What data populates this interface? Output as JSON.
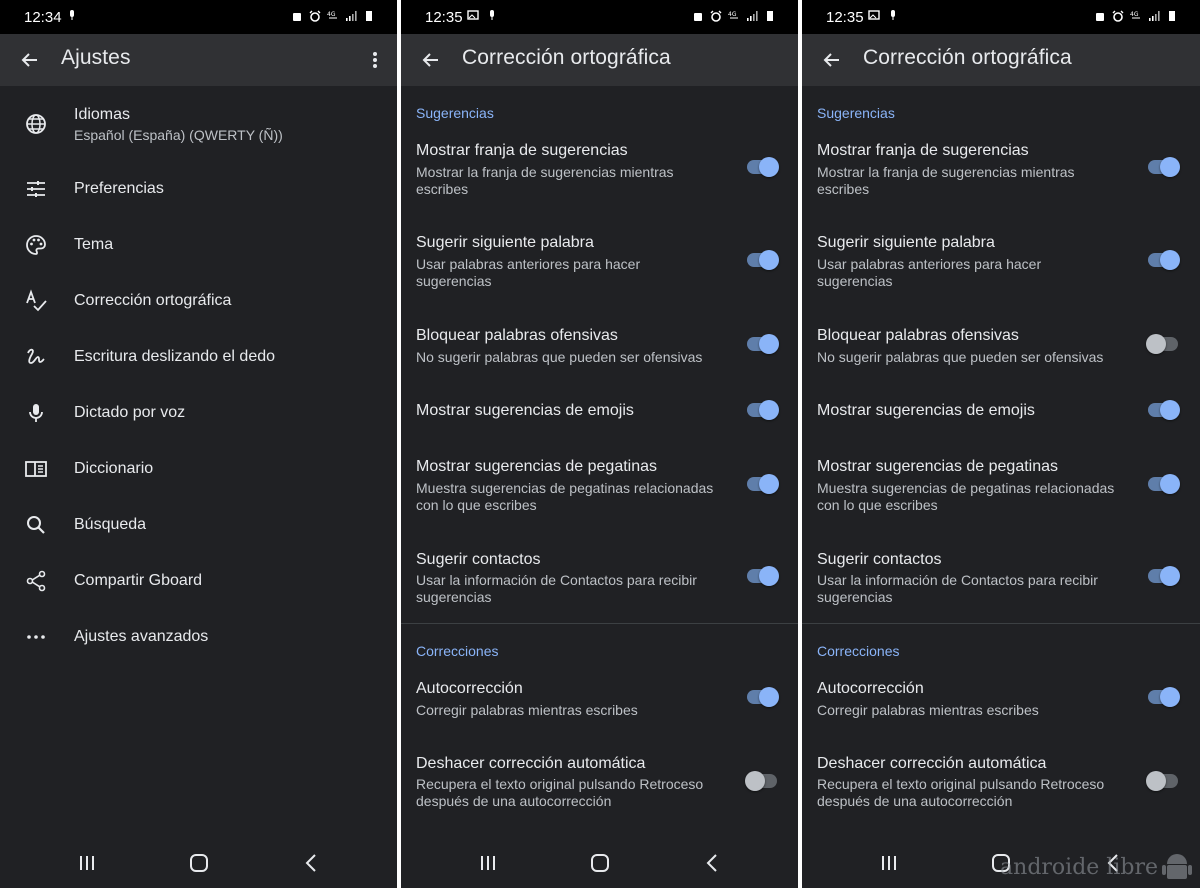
{
  "colors": {
    "accent": "#8ab4f8",
    "background": "#202124",
    "appbar": "#303134"
  },
  "panel1": {
    "status_time": "12:34",
    "title": "Ajustes",
    "items": [
      {
        "icon": "globe-icon",
        "label": "Idiomas",
        "sub": "Español (España) (QWERTY (Ñ))"
      },
      {
        "icon": "sliders-icon",
        "label": "Preferencias"
      },
      {
        "icon": "palette-icon",
        "label": "Tema"
      },
      {
        "icon": "spellcheck-icon",
        "label": "Corrección ortográfica"
      },
      {
        "icon": "gesture-icon",
        "label": "Escritura deslizando el dedo"
      },
      {
        "icon": "microphone-icon",
        "label": "Dictado por voz"
      },
      {
        "icon": "dictionary-icon",
        "label": "Diccionario"
      },
      {
        "icon": "search-icon",
        "label": "Búsqueda"
      },
      {
        "icon": "share-icon",
        "label": "Compartir Gboard"
      },
      {
        "icon": "more-horizontal-icon",
        "label": "Ajustes avanzados"
      }
    ]
  },
  "panel2": {
    "status_time": "12:35",
    "title": "Corrección ortográfica",
    "section_suggestions": "Sugerencias",
    "section_corrections": "Correcciones",
    "prefs": [
      {
        "title": "Mostrar franja de sugerencias",
        "summary": "Mostrar la franja de sugerencias mientras escribes",
        "on": true
      },
      {
        "title": "Sugerir siguiente palabra",
        "summary": "Usar palabras anteriores para hacer sugerencias",
        "on": true
      },
      {
        "title": "Bloquear palabras ofensivas",
        "summary": "No sugerir palabras que pueden ser ofensivas",
        "on": true
      },
      {
        "title": "Mostrar sugerencias de emojis",
        "summary": "",
        "on": true
      },
      {
        "title": "Mostrar sugerencias de pegatinas",
        "summary": "Muestra sugerencias de pegatinas relacionadas con lo que escribes",
        "on": true
      },
      {
        "title": "Sugerir contactos",
        "summary": "Usar la información de Contactos para recibir sugerencias",
        "on": true
      },
      {
        "title": "Autocorrección",
        "summary": "Corregir palabras mientras escribes",
        "on": true
      },
      {
        "title": "Deshacer corrección automática",
        "summary": "Recupera el texto original pulsando Retroceso después de una autocorrección",
        "on": false
      }
    ]
  },
  "panel3": {
    "status_time": "12:35",
    "title": "Corrección ortográfica",
    "section_suggestions": "Sugerencias",
    "section_corrections": "Correcciones",
    "prefs": [
      {
        "title": "Mostrar franja de sugerencias",
        "summary": "Mostrar la franja de sugerencias mientras escribes",
        "on": true
      },
      {
        "title": "Sugerir siguiente palabra",
        "summary": "Usar palabras anteriores para hacer sugerencias",
        "on": true
      },
      {
        "title": "Bloquear palabras ofensivas",
        "summary": "No sugerir palabras que pueden ser ofensivas",
        "on": false
      },
      {
        "title": "Mostrar sugerencias de emojis",
        "summary": "",
        "on": true
      },
      {
        "title": "Mostrar sugerencias de pegatinas",
        "summary": "Muestra sugerencias de pegatinas relacionadas con lo que escribes",
        "on": true
      },
      {
        "title": "Sugerir contactos",
        "summary": "Usar la información de Contactos para recibir sugerencias",
        "on": true
      },
      {
        "title": "Autocorrección",
        "summary": "Corregir palabras mientras escribes",
        "on": true
      },
      {
        "title": "Deshacer corrección automática",
        "summary": "Recupera el texto original pulsando Retroceso después de una autocorrección",
        "on": false
      }
    ]
  },
  "watermark": "androide libre"
}
